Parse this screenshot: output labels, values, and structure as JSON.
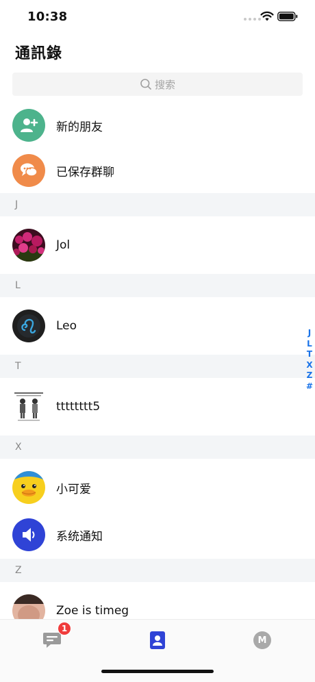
{
  "status_bar": {
    "time": "10:38"
  },
  "header": {
    "title": "通訊錄"
  },
  "search": {
    "placeholder": "搜索"
  },
  "shortcuts": [
    {
      "label": "新的朋友",
      "icon": "add-friend-icon",
      "color": "#4db38c"
    },
    {
      "label": "已保存群聊",
      "icon": "group-chat-icon",
      "color": "#f08b4a"
    }
  ],
  "sections": [
    {
      "letter": "J",
      "contacts": [
        {
          "name": "Jol",
          "avatar": "flower-photo-avatar"
        }
      ]
    },
    {
      "letter": "L",
      "contacts": [
        {
          "name": "Leo",
          "avatar": "leo-zodiac-avatar"
        }
      ]
    },
    {
      "letter": "T",
      "contacts": [
        {
          "name": "tttttttt5",
          "avatar": "comic-avatar"
        }
      ]
    },
    {
      "letter": "X",
      "contacts": [
        {
          "name": "小可爱",
          "avatar": "duck-avatar"
        },
        {
          "name": "系统通知",
          "avatar": "speaker-avatar"
        }
      ]
    },
    {
      "letter": "Z",
      "contacts": [
        {
          "name": "Zoe is timeg",
          "avatar": "photo-avatar"
        }
      ]
    }
  ],
  "index_bar": [
    "J",
    "L",
    "T",
    "X",
    "Z",
    "#"
  ],
  "tab_bar": {
    "messages_badge": "1",
    "me_initial": "M",
    "active_color": "#2f43d6"
  }
}
